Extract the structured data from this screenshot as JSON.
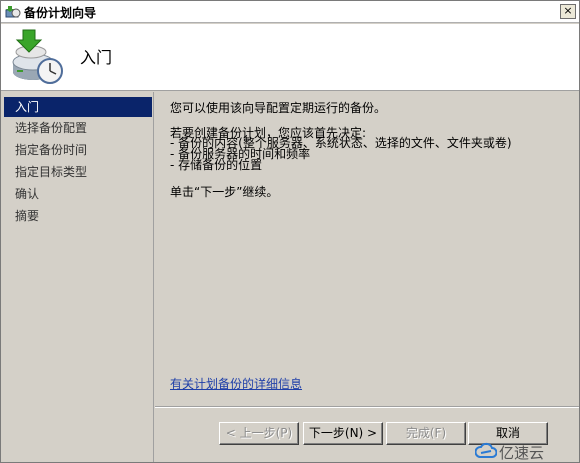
{
  "window": {
    "title": "备份计划向导",
    "close_glyph": "×"
  },
  "header": {
    "title": "入门"
  },
  "nav": {
    "items": [
      {
        "label": "入门",
        "active": true
      },
      {
        "label": "选择备份配置",
        "active": false
      },
      {
        "label": "指定备份时间",
        "active": false
      },
      {
        "label": "指定目标类型",
        "active": false
      },
      {
        "label": "确认",
        "active": false
      },
      {
        "label": "摘要",
        "active": false
      }
    ]
  },
  "content": {
    "intro": "您可以使用该向导配置定期运行的备份。",
    "decide": "若要创建备份计划，您应该首先决定:",
    "bullets": [
      "- 备份的内容(整个服务器、系统状态、选择的文件、文件夹或卷)",
      "- 备份服务器的时间和频率",
      "- 存储备份的位置"
    ],
    "next_hint": "单击“下一步”继续。",
    "link": "有关计划备份的详细信息"
  },
  "buttons": {
    "back": "< 上一步(P)",
    "next": "下一步(N) >",
    "finish": "完成(F)",
    "cancel": "取消"
  },
  "watermark": {
    "text": "亿速云"
  }
}
